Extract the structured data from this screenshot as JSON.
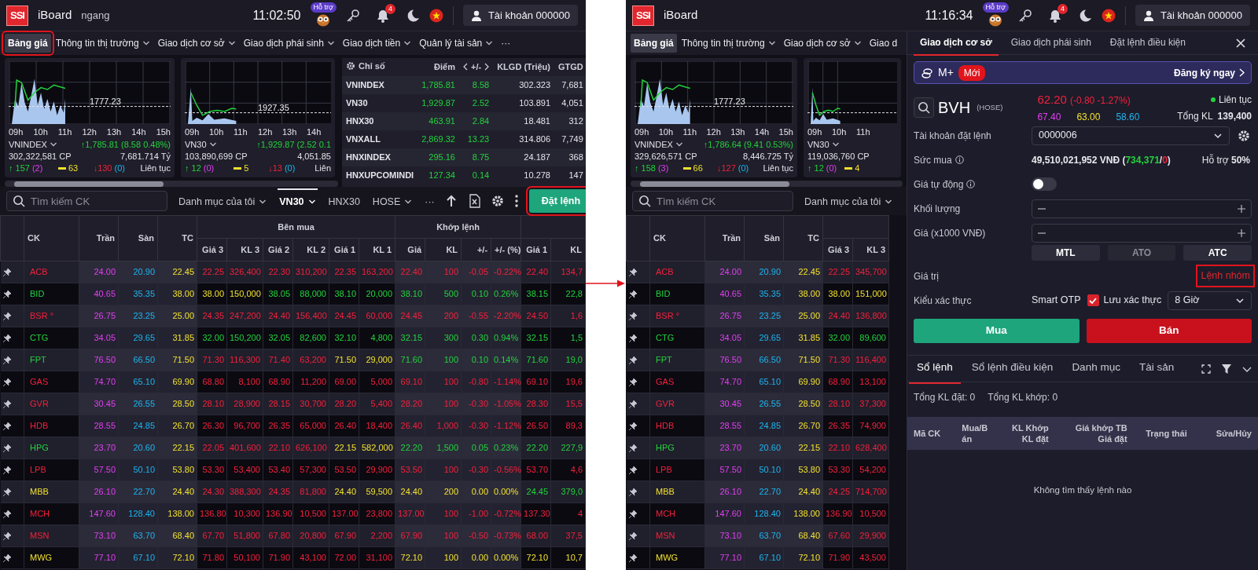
{
  "screens": [
    {
      "header": {
        "logo": "SSI",
        "app": "iBoard",
        "mode": "ngang",
        "clock": "11:02:50",
        "support": "Hỗ trợ",
        "notifications": "4",
        "account": "Tài khoản 000000"
      },
      "menu": [
        {
          "label": "Bảng giá",
          "dropdown": false,
          "selected": true,
          "highlighted": true
        },
        {
          "label": "Thông tin thị trường",
          "dropdown": true,
          "selected": false,
          "highlighted": false
        },
        {
          "label": "Giao dịch cơ sở",
          "dropdown": true,
          "selected": false,
          "highlighted": false
        },
        {
          "label": "Giao dịch phái sinh",
          "dropdown": true,
          "selected": false,
          "highlighted": false
        },
        {
          "label": "Giao dịch tiền",
          "dropdown": true,
          "selected": false,
          "highlighted": false
        },
        {
          "label": "Quản lý tài sản",
          "dropdown": true,
          "selected": false,
          "highlighted": false
        },
        {
          "label": "···",
          "dropdown": false,
          "selected": false,
          "highlighted": false
        }
      ],
      "index_cards": [
        {
          "name": "VNINDEX",
          "reference": "1777.23",
          "times": [
            "09h",
            "10h",
            "11h",
            "12h",
            "13h",
            "14h",
            "15h"
          ],
          "change": "↑1,785.81 (8.58 0.48%)",
          "volume": "302,322,581 CP",
          "value": "7,681.714 Tỷ",
          "advances": "↑ 157",
          "ceilings": "(2)",
          "unchanged": "63",
          "declines": "↓130",
          "floors": "(0)",
          "session": "Liên tục"
        },
        {
          "name": "VN30",
          "reference": "1927.35",
          "times": [
            "09h",
            "10h",
            "11h",
            "12h",
            "13h",
            "14h"
          ],
          "change": "↑1,929.87 (2.52 0.1",
          "volume": "103,890,699 CP",
          "value": "4,051.85",
          "advances": "↑ 12",
          "ceilings": "(0)",
          "unchanged": "5",
          "declines": "↓13",
          "floors": "(0)",
          "session": "Liên"
        }
      ],
      "index_table": {
        "columns": [
          "Chỉ số",
          "Điểm",
          "+/-",
          "KLGD (Triệu)",
          "GTGD"
        ],
        "rows": [
          {
            "cells": [
              "VNINDEX",
              "1,785.81",
              "8.58",
              "302.323",
              "7,681"
            ]
          },
          {
            "cells": [
              "VN30",
              "1,929.87",
              "2.52",
              "103.891",
              "4,051"
            ]
          },
          {
            "cells": [
              "HNX30",
              "463.91",
              "2.84",
              "18.481",
              "312"
            ]
          },
          {
            "cells": [
              "VNXALL",
              "2,869.32",
              "13.23",
              "314.806",
              "7,749"
            ]
          },
          {
            "cells": [
              "HNXINDEX",
              "295.16",
              "8.75",
              "24.187",
              "368"
            ]
          },
          {
            "cells": [
              "HNXUPCOMINDI",
              "127.34",
              "0.14",
              "10.278",
              "147"
            ]
          }
        ]
      },
      "toolbar": {
        "search_placeholder": "Tìm kiếm CK",
        "filters": [
          {
            "label": "Danh mục của tôi",
            "dropdown": true,
            "selected": false
          },
          {
            "label": "VN30",
            "dropdown": true,
            "selected": true
          },
          {
            "label": "HNX30",
            "dropdown": false,
            "selected": false
          },
          {
            "label": "HOSE",
            "dropdown": true,
            "selected": false
          },
          {
            "label": "···",
            "dropdown": false,
            "selected": false
          }
        ],
        "order_button": {
          "label": "Đặt lệnh",
          "highlighted": true
        }
      },
      "price_table": {
        "fixed_columns": [
          {
            "label": "CK",
            "kind": "symbol"
          },
          {
            "label": "Trần",
            "kind": "ceiling"
          },
          {
            "label": "Sàn",
            "kind": "floor"
          },
          {
            "label": "TC",
            "kind": "reference"
          }
        ],
        "groups": [
          {
            "label": "Bên mua",
            "columns": [
              {
                "label": "Giá 3",
                "kind": "price"
              },
              {
                "label": "KL 3",
                "kind": "volume"
              },
              {
                "label": "Giá 2",
                "kind": "price"
              },
              {
                "label": "KL 2",
                "kind": "volume"
              },
              {
                "label": "Giá 1",
                "kind": "price"
              },
              {
                "label": "KL 1",
                "kind": "volume"
              }
            ]
          },
          {
            "label": "Khớp lệnh",
            "columns": [
              {
                "label": "Giá",
                "kind": "price"
              },
              {
                "label": "KL",
                "kind": "volume"
              },
              {
                "label": "+/-",
                "kind": "change"
              },
              {
                "label": "+/- (%)",
                "kind": "change"
              }
            ]
          },
          {
            "columns": [
              {
                "label": "Giá 1",
                "kind": "price"
              },
              {
                "label": "KL",
                "kind": "volume"
              }
            ]
          }
        ],
        "rows": [
          {
            "symbol": "ACB",
            "color": "#f3213b",
            "cells": [
              "24.00",
              "20.90",
              "22.45",
              "22.25",
              "326,400",
              "22.30",
              "310,200",
              "22.35",
              "163,200",
              "22.40",
              "100",
              "-0.05",
              "-0.22%",
              "22.40",
              "134,7"
            ]
          },
          {
            "symbol": "BID",
            "color": "#22d33c",
            "cells": [
              "40.65",
              "35.35",
              "38.00",
              "38.00",
              "150,000",
              "38.05",
              "88,000",
              "38.10",
              "20,000",
              "38.10",
              "500",
              "0.10",
              "0.26%",
              "38.15",
              "22,8"
            ]
          },
          {
            "symbol": "BSR °",
            "color": "#f3213b",
            "cells": [
              "26.75",
              "23.25",
              "25.00",
              "24.35",
              "247,200",
              "24.40",
              "156,400",
              "24.45",
              "60,000",
              "24.45",
              "200",
              "-0.55",
              "-2.20%",
              "24.50",
              "1,6"
            ]
          },
          {
            "symbol": "CTG",
            "color": "#22d33c",
            "cells": [
              "34.05",
              "29.65",
              "31.85",
              "32.00",
              "150,200",
              "32.05",
              "82,600",
              "32.10",
              "4,800",
              "32.15",
              "300",
              "0.30",
              "0.94%",
              "32.15",
              "1,5"
            ]
          },
          {
            "symbol": "FPT",
            "color": "#22d33c",
            "cells": [
              "76.50",
              "66.50",
              "71.50",
              "71.30",
              "116,300",
              "71.40",
              "63,200",
              "71.50",
              "29,000",
              "71.60",
              "100",
              "0.10",
              "0.14%",
              "71.60",
              "19,0"
            ]
          },
          {
            "symbol": "GAS",
            "color": "#f3213b",
            "cells": [
              "74.70",
              "65.10",
              "69.90",
              "68.80",
              "8,100",
              "68.90",
              "11,200",
              "69.00",
              "5,000",
              "69.10",
              "100",
              "-0.80",
              "-1.14%",
              "69.10",
              "19,6"
            ]
          },
          {
            "symbol": "GVR",
            "color": "#f3213b",
            "cells": [
              "30.45",
              "26.55",
              "28.50",
              "28.10",
              "28,900",
              "28.15",
              "30,700",
              "28.20",
              "5,400",
              "28.20",
              "100",
              "-0.30",
              "-1.05%",
              "28.30",
              "15,5"
            ]
          },
          {
            "symbol": "HDB",
            "color": "#f3213b",
            "cells": [
              "28.55",
              "24.85",
              "26.70",
              "26.30",
              "96,700",
              "26.35",
              "65,000",
              "26.40",
              "18,400",
              "26.40",
              "1,000",
              "-0.30",
              "-1.12%",
              "26.50",
              "89,3"
            ]
          },
          {
            "symbol": "HPG",
            "color": "#22d33c",
            "cells": [
              "23.70",
              "20.60",
              "22.15",
              "22.05",
              "401,600",
              "22.10",
              "626,100",
              "22.15",
              "582,000",
              "22.20",
              "1,500",
              "0.05",
              "0.23%",
              "22.20",
              "227,9"
            ]
          },
          {
            "symbol": "LPB",
            "color": "#f3213b",
            "cells": [
              "57.50",
              "50.10",
              "53.80",
              "53.30",
              "53,400",
              "53.40",
              "57,300",
              "53.50",
              "29,900",
              "53.50",
              "100",
              "-0.30",
              "-0.56%",
              "53.70",
              "4,6"
            ]
          },
          {
            "symbol": "MBB",
            "color": "#f1e12f",
            "cells": [
              "26.10",
              "22.70",
              "24.40",
              "24.30",
              "388,300",
              "24.35",
              "81,800",
              "24.40",
              "59,500",
              "24.40",
              "200",
              "0.00",
              "0.00%",
              "24.45",
              "379,0"
            ]
          },
          {
            "symbol": "MCH",
            "color": "#f3213b",
            "cells": [
              "147.60",
              "128.40",
              "138.00",
              "136.80",
              "10,300",
              "136.90",
              "10,500",
              "137.00",
              "23,800",
              "137.00",
              "100",
              "-1.00",
              "-0.72%",
              "137.30",
              "4"
            ]
          },
          {
            "symbol": "MSN",
            "color": "#f3213b",
            "cells": [
              "73.10",
              "63.70",
              "68.40",
              "67.70",
              "51,800",
              "67.80",
              "20,800",
              "67.90",
              "2,200",
              "67.90",
              "100",
              "-0.50",
              "-0.73%",
              "68.00",
              "37,5"
            ]
          },
          {
            "symbol": "MWG",
            "color": "#f1e12f",
            "cells": [
              "77.10",
              "67.10",
              "72.10",
              "71.80",
              "50,100",
              "71.90",
              "43,100",
              "72.00",
              "31,100",
              "72.10",
              "100",
              "0.00",
              "0.00%",
              "72.10",
              "10,7"
            ]
          }
        ]
      }
    },
    {
      "header": {
        "logo": "SSI",
        "app": "iBoard",
        "clock": "11:16:34",
        "support": "Hỗ trợ",
        "notifications": "4",
        "account": "Tài khoản 000000"
      },
      "menu": [
        {
          "label": "Bảng giá",
          "dropdown": false,
          "selected": true,
          "highlighted": false
        },
        {
          "label": "Thông tin thị trường",
          "dropdown": true,
          "selected": false,
          "highlighted": false
        },
        {
          "label": "Giao dịch cơ sở",
          "dropdown": true,
          "selected": false,
          "highlighted": false
        },
        {
          "label": "Giao d",
          "dropdown": false,
          "selected": false,
          "highlighted": false
        }
      ],
      "index_cards": [
        {
          "name": "VNINDEX",
          "reference": "1777.23",
          "times": [
            "09h",
            "10h",
            "11h",
            "12h",
            "13h",
            "14h",
            "15h"
          ],
          "change": "↑1,786.64 (9.41 0.53%)",
          "volume": "329,626,571 CP",
          "value": "8,446.725 Tỷ",
          "advances": "↑ 158",
          "ceilings": "(3)",
          "unchanged": "66",
          "declines": "↓127",
          "floors": "(0)",
          "session": "Liên tục"
        },
        {
          "name": "VN30",
          "times": [
            "09h",
            "10h",
            "11h"
          ],
          "volume": "119,036,760 CP",
          "advances": "↑ 12",
          "ceilings": "(0)",
          "unchanged": "4"
        }
      ],
      "toolbar": {
        "search_placeholder": "Tìm kiếm CK",
        "filters": [
          {
            "label": "Danh mục của tôi",
            "dropdown": true,
            "selected": false
          }
        ]
      },
      "price_table": {
        "fixed_columns": [
          {
            "label": "CK",
            "kind": "symbol"
          },
          {
            "label": "Trần",
            "kind": "ceiling"
          },
          {
            "label": "Sàn",
            "kind": "floor"
          },
          {
            "label": "TC",
            "kind": "reference"
          }
        ],
        "groups": [
          {
            "columns": [
              {
                "label": "Giá 3",
                "kind": "price"
              },
              {
                "label": "KL 3",
                "kind": "volume"
              }
            ]
          }
        ],
        "rows": [
          {
            "symbol": "ACB",
            "color": "#f3213b",
            "cells": [
              "24.00",
              "20.90",
              "22.45",
              "22.25",
              "345,700"
            ]
          },
          {
            "symbol": "BID",
            "color": "#22d33c",
            "cells": [
              "40.65",
              "35.35",
              "38.00",
              "38.00",
              "151,000"
            ]
          },
          {
            "symbol": "BSR °",
            "color": "#f3213b",
            "cells": [
              "26.75",
              "23.25",
              "25.00",
              "24.40",
              "136,800"
            ]
          },
          {
            "symbol": "CTG",
            "color": "#22d33c",
            "cells": [
              "34.05",
              "29.65",
              "31.85",
              "32.00",
              "89,600"
            ]
          },
          {
            "symbol": "FPT",
            "color": "#22d33c",
            "cells": [
              "76.50",
              "66.50",
              "71.50",
              "71.30",
              "116,400"
            ]
          },
          {
            "symbol": "GAS",
            "color": "#f3213b",
            "cells": [
              "74.70",
              "65.10",
              "69.90",
              "68.90",
              "13,100"
            ]
          },
          {
            "symbol": "GVR",
            "color": "#f3213b",
            "cells": [
              "30.45",
              "26.55",
              "28.50",
              "28.10",
              "37,300"
            ]
          },
          {
            "symbol": "HDB",
            "color": "#f3213b",
            "cells": [
              "28.55",
              "24.85",
              "26.70",
              "26.35",
              "74,900"
            ]
          },
          {
            "symbol": "HPG",
            "color": "#22d33c",
            "cells": [
              "23.70",
              "20.60",
              "22.15",
              "22.10",
              "628,400"
            ]
          },
          {
            "symbol": "LPB",
            "color": "#f3213b",
            "cells": [
              "57.50",
              "50.10",
              "53.80",
              "53.30",
              "54,200"
            ]
          },
          {
            "symbol": "MBB",
            "color": "#f1e12f",
            "cells": [
              "26.10",
              "22.70",
              "24.40",
              "24.25",
              "714,700"
            ]
          },
          {
            "symbol": "MCH",
            "color": "#f3213b",
            "cells": [
              "147.60",
              "128.40",
              "138.00",
              "136.90",
              "10,500"
            ]
          },
          {
            "symbol": "MSN",
            "color": "#f3213b",
            "cells": [
              "73.10",
              "63.70",
              "68.40",
              "67.60",
              "29,900"
            ]
          },
          {
            "symbol": "MWG",
            "color": "#f1e12f",
            "cells": [
              "77.10",
              "67.10",
              "72.10",
              "71.90",
              "43,500"
            ]
          }
        ]
      },
      "order_panel": {
        "tabs": [
          {
            "label": "Giao dịch cơ sở",
            "selected": true
          },
          {
            "label": "Giao dịch phái sinh",
            "selected": false
          },
          {
            "label": "Đặt lệnh điều kiện",
            "selected": false
          }
        ],
        "banner": {
          "title": "M+",
          "badge": "Mới",
          "action": "Đăng ký ngay"
        },
        "quote": {
          "symbol": "BVH",
          "exchange": "(HOSE)",
          "price": "62.20",
          "change": "(-0.80 -1.27%)",
          "color": "#f3213b",
          "ceiling": "67.40",
          "reference": "63.00",
          "floor": "58.60",
          "session": "Liên tục",
          "volume_label": "Tổng KL",
          "volume": "139,400"
        },
        "account": {
          "label": "Tài khoản đặt lệnh",
          "value": "0000006"
        },
        "buying_power": {
          "label": "Sức mua",
          "parts": [
            {
              "text": "49,510,021,952 VNĐ ("
            },
            {
              "text": "734,371",
              "color": "#22d33c"
            },
            {
              "text": "/"
            },
            {
              "text": "0",
              "color": "#f3213b"
            },
            {
              "text": ")"
            }
          ],
          "margin": "Hỗ trợ **50%**"
        },
        "auto_price": {
          "label": "Giá tự động",
          "on": false
        },
        "quantity": {
          "label": "Khối lượng"
        },
        "price": {
          "label": "Giá (x1000 VNĐ)"
        },
        "order_types": [
          {
            "label": "MTL",
            "disabled": false
          },
          {
            "label": "ATO",
            "disabled": true
          },
          {
            "label": "ATC",
            "disabled": false
          }
        ],
        "value": {
          "label": "Giá trị"
        },
        "group_order": {
          "label": "Lệnh nhóm",
          "highlighted": true
        },
        "auth": {
          "label": "Kiểu xác thực",
          "method": "Smart OTP",
          "remember": {
            "label": "Lưu xác thực",
            "checked": true
          },
          "duration": "8 Giờ"
        },
        "actions": [
          {
            "label": "Mua",
            "kind": "buy"
          },
          {
            "label": "Bán",
            "kind": "sell"
          }
        ]
      },
      "order_book": {
        "tabs": [
          {
            "label": "Sổ lệnh",
            "selected": true
          },
          {
            "label": "Sổ lệnh điều kiện",
            "selected": false
          },
          {
            "label": "Danh mục",
            "selected": false
          },
          {
            "label": "Tài sản",
            "selected": false
          }
        ],
        "summary": [
          "Tổng KL đặt: 0",
          "Tổng KL khớp: 0"
        ],
        "columns": [
          {
            "lines": [
              "Mã CK"
            ]
          },
          {
            "lines": [
              "Mua/Bán"
            ]
          },
          {
            "lines": [
              "KL Khớp",
              "KL đặt"
            ]
          },
          {
            "lines": [
              "Giá khớp TB",
              "Giá đặt"
            ]
          },
          {
            "lines": [
              "Trạng thái"
            ]
          },
          {
            "lines": [
              "Sửa/Hủy"
            ]
          }
        ],
        "empty": "Không tìm thấy lệnh nào"
      }
    }
  ]
}
